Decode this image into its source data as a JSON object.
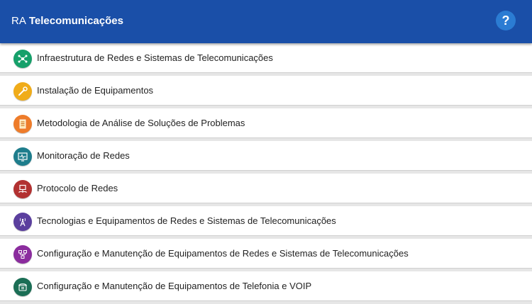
{
  "header": {
    "title_prefix": "RA",
    "title": "Telecomunicações",
    "help_label": "?"
  },
  "colors": {
    "app_bar": "#1a4fa8",
    "help_button": "#2b7cd3"
  },
  "items": [
    {
      "label": "Infraestrutura de Redes e Sistemas de Telecomunicações",
      "icon": "network-nodes-icon",
      "color": "#16a06a"
    },
    {
      "label": "Instalação de Equipamentos",
      "icon": "wrench-icon",
      "color": "#f0ac1a"
    },
    {
      "label": "Metodologia de Análise de Soluções de Problemas",
      "icon": "document-icon",
      "color": "#ee7c2a"
    },
    {
      "label": "Monitoração de Redes",
      "icon": "monitor-pulse-icon",
      "color": "#1e7d8c"
    },
    {
      "label": "Protocolo de Redes",
      "icon": "network-computer-icon",
      "color": "#b23131"
    },
    {
      "label": "Tecnologias e Equipamentos de Redes e Sistemas de Telecomunicações",
      "icon": "antenna-tower-icon",
      "color": "#5b3f9e"
    },
    {
      "label": "Configuração e Manutenção de Equipamentos de Redes e Sistemas de Telecomunicações",
      "icon": "network-config-icon",
      "color": "#8b2c9e"
    },
    {
      "label": "Configuração e Manutenção de Equipamentos de Telefonia e VOIP",
      "icon": "telephone-icon",
      "color": "#1b6e55"
    }
  ]
}
